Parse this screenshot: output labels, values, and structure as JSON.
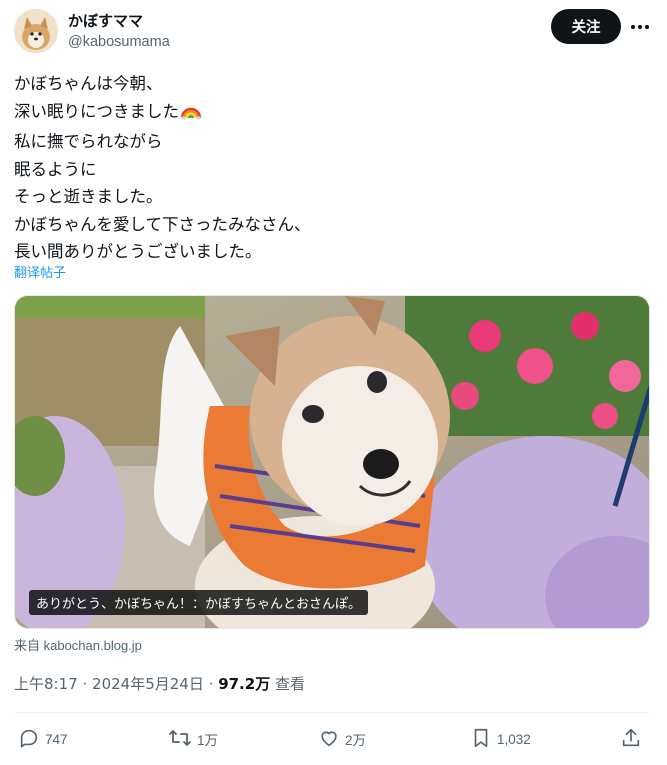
{
  "author": {
    "display_name": "かぼすママ",
    "handle": "@kabosumama",
    "follow_label": "关注"
  },
  "tweet": {
    "lines": [
      "かぼちゃんは今朝、",
      "深い眠りにつきました",
      "私に撫でられながら",
      "眠るように",
      "そっと逝きました。",
      "かぼちゃんを愛して下さったみなさん、",
      "長い間ありがとうございました。"
    ],
    "translate_label": "翻译帖子"
  },
  "media": {
    "caption": "ありがとう、かぼちゃん！：かぼすちゃんとおさんぽ。"
  },
  "source": "来自 kabochan.blog.jp",
  "meta": {
    "time": "上午8:17",
    "date": "2024年5月24日",
    "views_count": "97.2万",
    "views_label": "查看",
    "separator": "·"
  },
  "actions": {
    "replies": "747",
    "retweets": "1万",
    "likes": "2万",
    "bookmarks": "1,032"
  },
  "colors": {
    "accent": "#1d9bf0",
    "text": "#0f1419",
    "secondary": "#536471",
    "follow_bg": "#0f1419"
  },
  "icons": [
    "more-icon",
    "rainbow-emoji",
    "reply-icon",
    "retweet-icon",
    "like-icon",
    "bookmark-icon",
    "share-icon"
  ]
}
